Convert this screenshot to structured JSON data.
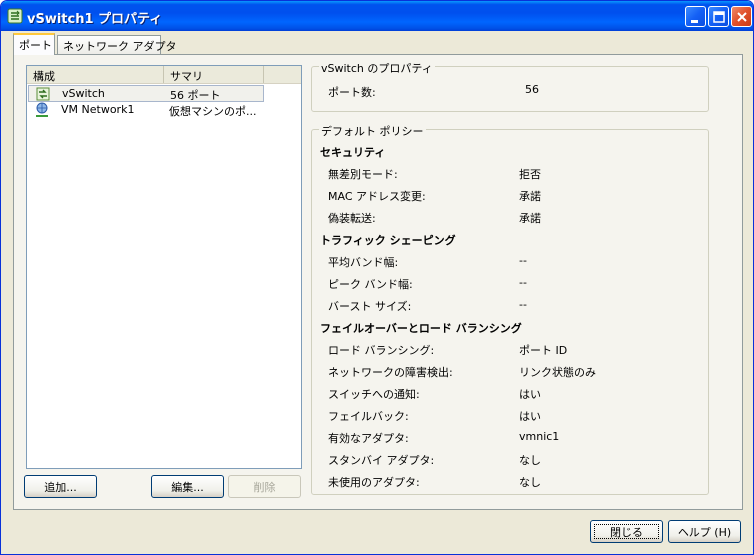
{
  "window": {
    "title": "vSwitch1 プロパティ"
  },
  "tabs": [
    {
      "label": "ポート",
      "active": true
    },
    {
      "label": "ネットワーク アダプタ",
      "active": false
    }
  ],
  "list": {
    "columns": [
      "構成",
      "サマリ"
    ],
    "rows": [
      {
        "name": "vSwitch",
        "summary": "56 ポート",
        "icon": "vswitch-icon",
        "selected": true
      },
      {
        "name": "VM Network1",
        "summary": "仮想マシンのポ...",
        "icon": "vm-network-icon",
        "selected": false
      }
    ]
  },
  "list_buttons": {
    "add": "追加...",
    "edit": "編集...",
    "delete": "削除"
  },
  "vswitch_props": {
    "legend": "vSwitch のプロパティ",
    "port_count_label": "ポート数:",
    "port_count_value": "56"
  },
  "default_policy": {
    "legend": "デフォルト ポリシー",
    "security": {
      "title": "セキュリティ",
      "items": [
        {
          "label": "無差別モード:",
          "value": "拒否"
        },
        {
          "label": "MAC アドレス変更:",
          "value": "承諾"
        },
        {
          "label": "偽装転送:",
          "value": "承諾"
        }
      ]
    },
    "traffic": {
      "title": "トラフィック シェーピング",
      "items": [
        {
          "label": "平均バンド幅:",
          "value": "--"
        },
        {
          "label": "ピーク バンド幅:",
          "value": "--"
        },
        {
          "label": "バースト サイズ:",
          "value": "--"
        }
      ]
    },
    "failover": {
      "title": "フェイルオーバーとロード バランシング",
      "items": [
        {
          "label": "ロード バランシング:",
          "value": "ポート ID"
        },
        {
          "label": "ネットワークの障害検出:",
          "value": "リンク状態のみ"
        },
        {
          "label": "スイッチへの通知:",
          "value": "はい"
        },
        {
          "label": "フェイルバック:",
          "value": "はい"
        },
        {
          "label": "有効なアダプタ:",
          "value": "vmnic1"
        },
        {
          "label": "スタンバイ アダプタ:",
          "value": "なし"
        },
        {
          "label": "未使用のアダプタ:",
          "value": "なし"
        }
      ]
    }
  },
  "footer": {
    "close": "閉じる",
    "help": "ヘルプ (H)"
  },
  "colors": {
    "titlebar": "#0053ee",
    "dialog_bg": "#ece9d8",
    "tab_highlight": "#ffc83c"
  }
}
